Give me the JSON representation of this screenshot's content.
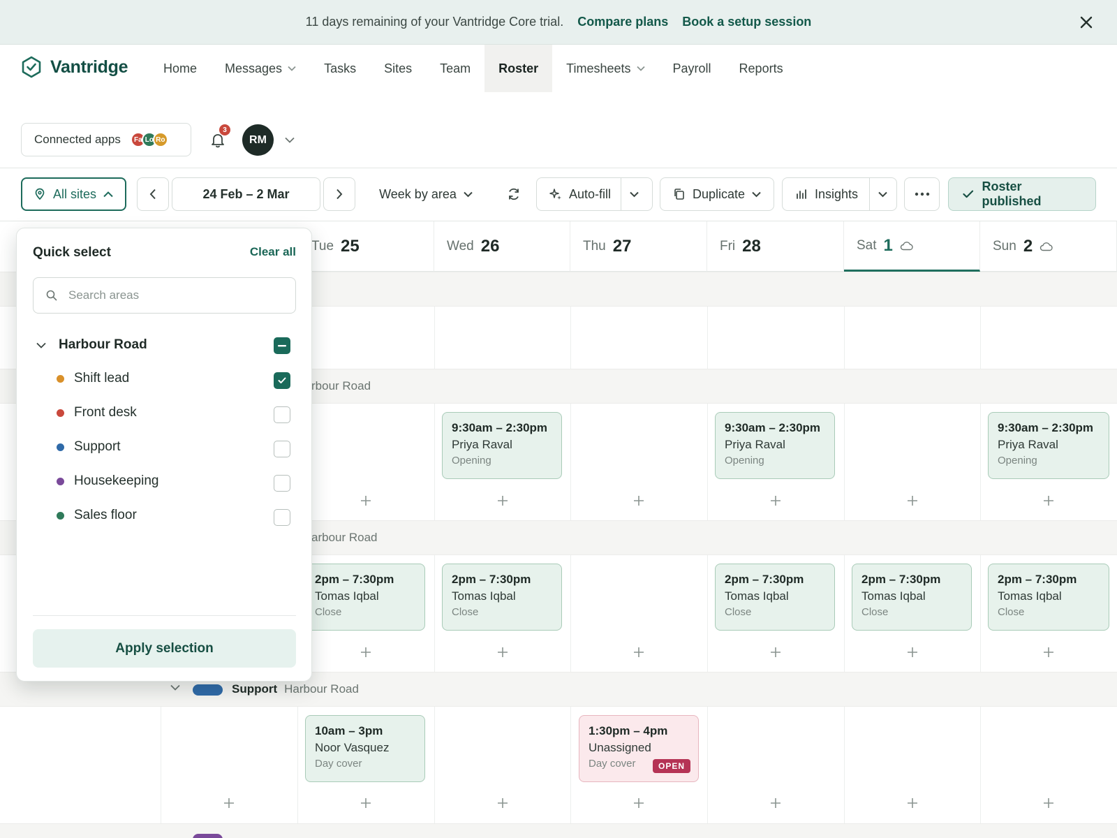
{
  "banner": {
    "message": "11 days remaining of your Vantridge Core trial.",
    "compare_label": "Compare plans",
    "book_label": "Book a setup session",
    "close_icon": "close-icon"
  },
  "brand": {
    "name": "Vantridge",
    "color": "#134e44"
  },
  "nav": {
    "items": [
      {
        "label": "Home",
        "has_menu": false
      },
      {
        "label": "Messages",
        "has_menu": true
      },
      {
        "label": "Tasks",
        "has_menu": false
      },
      {
        "label": "Sites",
        "has_menu": false
      },
      {
        "label": "Team",
        "has_menu": false
      },
      {
        "label": "Roster",
        "has_menu": false,
        "active": true
      },
      {
        "label": "Timesheets",
        "has_menu": true
      },
      {
        "label": "Payroll",
        "has_menu": false
      },
      {
        "label": "Reports",
        "has_menu": false
      }
    ]
  },
  "utility": {
    "connected_apps_label": "Connected apps",
    "app_avatars": [
      {
        "initials": "Fa",
        "color": "#c9483c"
      },
      {
        "initials": "Lo",
        "color": "#2f7a5a"
      },
      {
        "initials": "Ro",
        "color": "#d69a2a"
      }
    ],
    "notification_count": "3",
    "user_initials": "RM"
  },
  "toolbar": {
    "sites_label": "All sites",
    "date_range": "24 Feb – 2 Mar",
    "view_label": "Week by area",
    "autofill_label": "Auto-fill",
    "duplicate_label": "Duplicate",
    "insights_label": "Insights",
    "published_label": "Roster published"
  },
  "days": [
    {
      "name": "Tue",
      "num": "25"
    },
    {
      "name": "Wed",
      "num": "26"
    },
    {
      "name": "Thu",
      "num": "27"
    },
    {
      "name": "Fri",
      "num": "28"
    },
    {
      "name": "Sat",
      "num": "1",
      "weather": "cloud-icon",
      "selected": true
    },
    {
      "name": "Sun",
      "num": "2",
      "weather": "cloud-icon"
    }
  ],
  "bands": {
    "band1_site": "rbour Road",
    "band2_site": "arbour Road",
    "support": {
      "label": "Support",
      "site": "Harbour Road",
      "color": "#2f6aa8"
    }
  },
  "shifts": {
    "opening_wed": {
      "time": "9:30am – 2:30pm",
      "name": "Priya Raval",
      "role": "Opening"
    },
    "opening_fri": {
      "time": "9:30am – 2:30pm",
      "name": "Priya Raval",
      "role": "Opening"
    },
    "opening_sun": {
      "time": "9:30am – 2:30pm",
      "name": "Priya Raval",
      "role": "Opening"
    },
    "close_tue": {
      "time": "2pm – 7:30pm",
      "name": "Tomas Iqbal",
      "role": "Close"
    },
    "close_wed": {
      "time": "2pm – 7:30pm",
      "name": "Tomas Iqbal",
      "role": "Close"
    },
    "close_fri": {
      "time": "2pm – 7:30pm",
      "name": "Tomas Iqbal",
      "role": "Close"
    },
    "close_sat": {
      "time": "2pm – 7:30pm",
      "name": "Tomas Iqbal",
      "role": "Close"
    },
    "close_sun": {
      "time": "2pm – 7:30pm",
      "name": "Tomas Iqbal",
      "role": "Close"
    },
    "day_tue": {
      "time": "10am – 3pm",
      "name": "Noor Vasquez",
      "role": "Day cover"
    },
    "day_thu": {
      "time": "1:30pm – 4pm",
      "name": "Unassigned",
      "role": "Day cover",
      "badge": "OPEN"
    }
  },
  "quick_select": {
    "title": "Quick select",
    "clear_label": "Clear all",
    "search_placeholder": "Search areas",
    "group_name": "Harbour Road",
    "areas": [
      {
        "label": "Shift lead",
        "color": "#d9902a",
        "checked": true
      },
      {
        "label": "Front desk",
        "color": "#c9483c",
        "checked": false
      },
      {
        "label": "Support",
        "color": "#2f6aa8",
        "checked": false
      },
      {
        "label": "Housekeeping",
        "color": "#7a4a9a",
        "checked": false
      },
      {
        "label": "Sales floor",
        "color": "#2f7a5a",
        "checked": false
      }
    ],
    "apply_label": "Apply selection"
  }
}
